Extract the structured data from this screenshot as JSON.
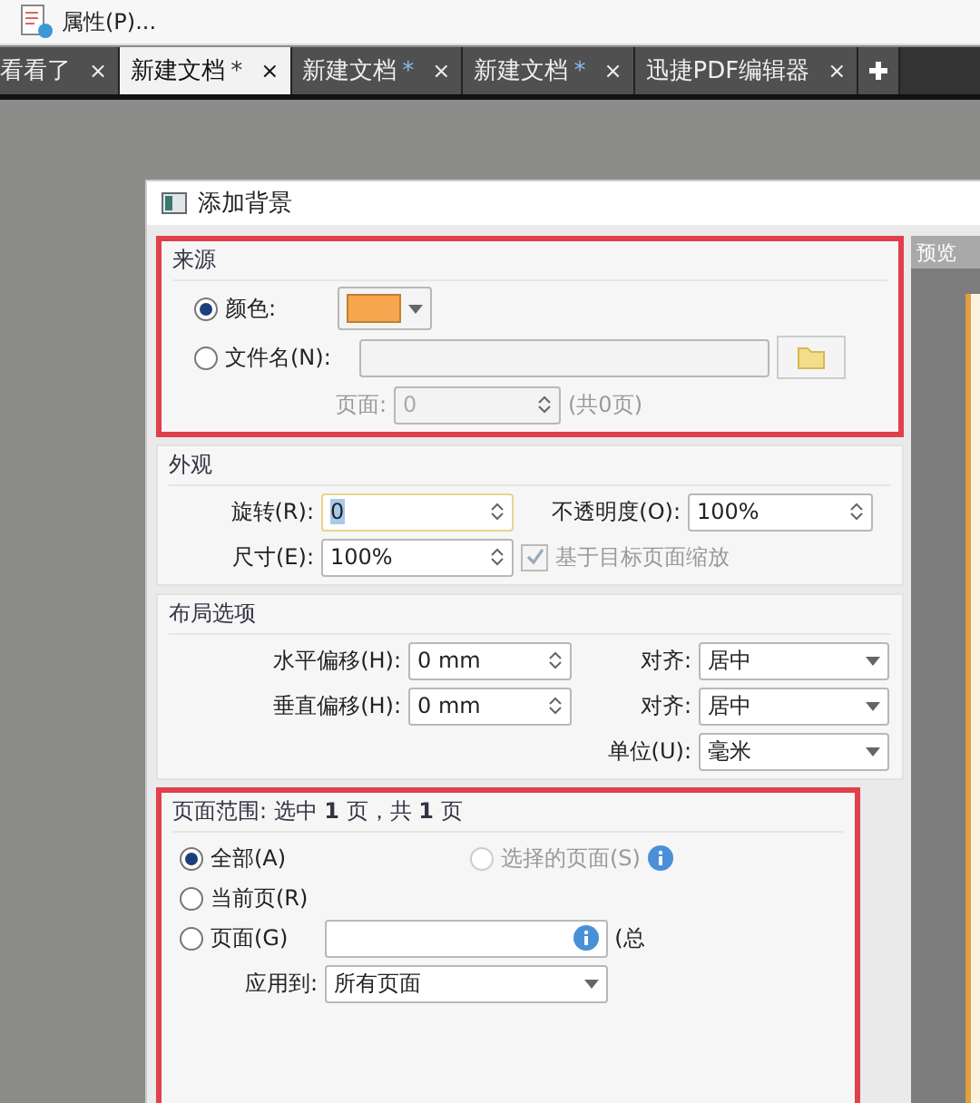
{
  "toolbar": {
    "label": "属性(P)..."
  },
  "tabs": [
    {
      "label": "看看了",
      "selected": false,
      "close": "×"
    },
    {
      "label": "新建文档",
      "mark": "*",
      "selected": true,
      "close": "×"
    },
    {
      "label": "新建文档",
      "mark": "*",
      "selected": false,
      "close": "×"
    },
    {
      "label": "新建文档",
      "mark": "*",
      "selected": false,
      "close": "×"
    },
    {
      "label": "迅捷PDF编辑器",
      "selected": false,
      "close": "×"
    }
  ],
  "dialog": {
    "title": "添加背景",
    "preview_title": "预览",
    "source": {
      "title": "来源",
      "highlighted": true,
      "options": [
        {
          "kind": "color",
          "label": "颜色:",
          "selected": true,
          "color": "#f7a54e"
        },
        {
          "kind": "file",
          "label": "文件名(N):",
          "selected": false
        }
      ],
      "page": {
        "label": "页面:",
        "value": "0",
        "disabled": true,
        "total": "(共0页)"
      }
    },
    "appearance": {
      "title": "外观",
      "highlighted": false,
      "rotation": {
        "label": "旋转(R):",
        "value": "0",
        "focused": true
      },
      "opacity": {
        "label": "不透明度(O):",
        "value": "100%",
        "focused": false
      },
      "size": {
        "label": "尺寸(E):",
        "value": "100%",
        "focused": false
      },
      "scale": {
        "label": "基于目标页面缩放",
        "checked": true,
        "disabled": true
      }
    },
    "layout": {
      "title": "布局选项",
      "highlighted": false,
      "rows": [
        {
          "offset": {
            "label": "水平偏移(H):",
            "value": "0 mm"
          },
          "align": {
            "label": "对齐:",
            "value": "居中"
          }
        },
        {
          "offset": {
            "label": "垂直偏移(H):",
            "value": "0 mm"
          },
          "align": {
            "label": "对齐:",
            "value": "居中"
          }
        },
        {
          "align": {
            "label": "单位(U):",
            "value": "毫米"
          }
        }
      ]
    },
    "range": {
      "title": "页面范围: 选中 **1** 页，共 **1** 页",
      "highlighted": true,
      "options": [
        {
          "kind": "all",
          "label": "全部(A)",
          "selected": true,
          "disabled": false
        },
        {
          "kind": "selection",
          "label": "选择的页面(S)",
          "selected": false,
          "disabled": true
        },
        {
          "kind": "current",
          "label": "当前页(R)",
          "selected": false,
          "disabled": false
        },
        {
          "kind": "pages",
          "label": "页面(G)",
          "selected": false,
          "disabled": false,
          "note": "(总"
        }
      ],
      "apply": {
        "label": "应用到:",
        "value": "所有页面"
      }
    }
  }
}
